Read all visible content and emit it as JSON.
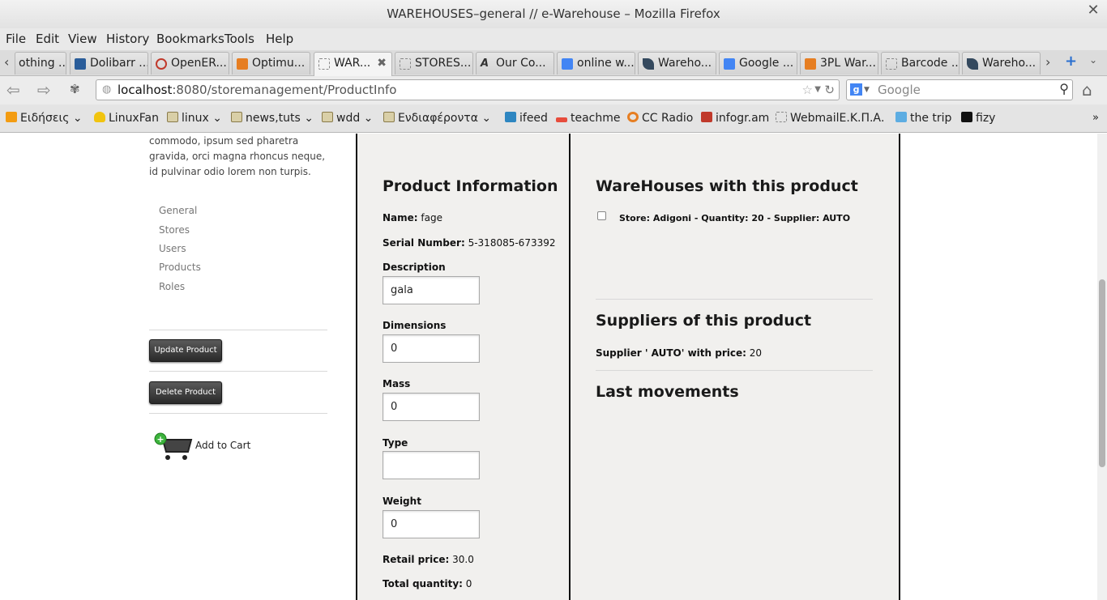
{
  "window": {
    "title": "WAREHOUSES–general // e-Warehouse – Mozilla Firefox"
  },
  "menu": [
    "File",
    "Edit",
    "View",
    "History",
    "Bookmarks",
    "Tools",
    "Help"
  ],
  "tabs": [
    {
      "label": "othing ...",
      "color": "#888888"
    },
    {
      "label": "Dolibarr ...",
      "color": "#2a5d9a"
    },
    {
      "label": "OpenER...",
      "color": "#c0392b"
    },
    {
      "label": "Optimu...",
      "color": "#e67e22"
    },
    {
      "label": "WAR...",
      "color": "#ffffff",
      "active": true
    },
    {
      "label": "STORES...",
      "color": "#ffffff"
    },
    {
      "label": "Our Co...",
      "color": "#333333"
    },
    {
      "label": "online w...",
      "color": "#4285f4"
    },
    {
      "label": "Wareho...",
      "color": "#34495e"
    },
    {
      "label": "Google ...",
      "color": "#4285f4"
    },
    {
      "label": "3PL War...",
      "color": "#e67e22"
    },
    {
      "label": "Barcode ...",
      "color": "#ffffff"
    },
    {
      "label": "Wareho...",
      "color": "#34495e"
    }
  ],
  "nav": {
    "url_host": "localhost",
    "url_rest": ":8080/storemanagement/ProductInfo",
    "search_placeholder": "Google"
  },
  "bookmarks": [
    {
      "label": "Ειδήσεις",
      "kind": "rss",
      "menu": true
    },
    {
      "label": "LinuxFan",
      "kind": "tux"
    },
    {
      "label": "linux",
      "kind": "folder",
      "menu": true
    },
    {
      "label": "news,tuts",
      "kind": "folder",
      "menu": true
    },
    {
      "label": "wdd",
      "kind": "folder",
      "menu": true
    },
    {
      "label": "Ενδιαφέροντα",
      "kind": "folder",
      "menu": true
    },
    {
      "label": "ifeed",
      "kind": "site"
    },
    {
      "label": "teachme",
      "kind": "site"
    },
    {
      "label": "CC Radio",
      "kind": "site"
    },
    {
      "label": "infogr.am",
      "kind": "site"
    },
    {
      "label": "WebmailΕ.Κ.Π.Α.",
      "kind": "site"
    },
    {
      "label": "the trip",
      "kind": "site"
    },
    {
      "label": "fizy",
      "kind": "site"
    }
  ],
  "sidebar": {
    "lorem": "commodo, ipsum sed pharetra gravida, orci magna rhoncus neque, id pulvinar odio lorem non turpis.",
    "links": [
      "General",
      "Stores",
      "Users",
      "Products",
      "Roles"
    ],
    "update_button": "Update Product",
    "delete_button": "Delete Product",
    "cart_label": "Add to Cart"
  },
  "product": {
    "heading": "Product Information",
    "name_label": "Name:",
    "name": "fage",
    "serial_label": "Serial Number:",
    "serial": "5-318085-673392",
    "description_label": "Description",
    "description": "gala",
    "dimensions_label": "Dimensions",
    "dimensions": "0",
    "mass_label": "Mass",
    "mass": "0",
    "type_label": "Type",
    "type": "",
    "weight_label": "Weight",
    "weight": "0",
    "retail_label": "Retail price:",
    "retail": "30.0",
    "total_label": "Total quantity:",
    "total": "0"
  },
  "warehouses": {
    "heading": "WareHouses with this product",
    "entry": "Store: Adigoni - Quantity: 20 - Supplier: AUTO"
  },
  "suppliers": {
    "heading": "Suppliers of this product",
    "entry_label": "Supplier ' AUTO' with price:",
    "entry_value": "20"
  },
  "movements": {
    "heading": "Last movements"
  }
}
